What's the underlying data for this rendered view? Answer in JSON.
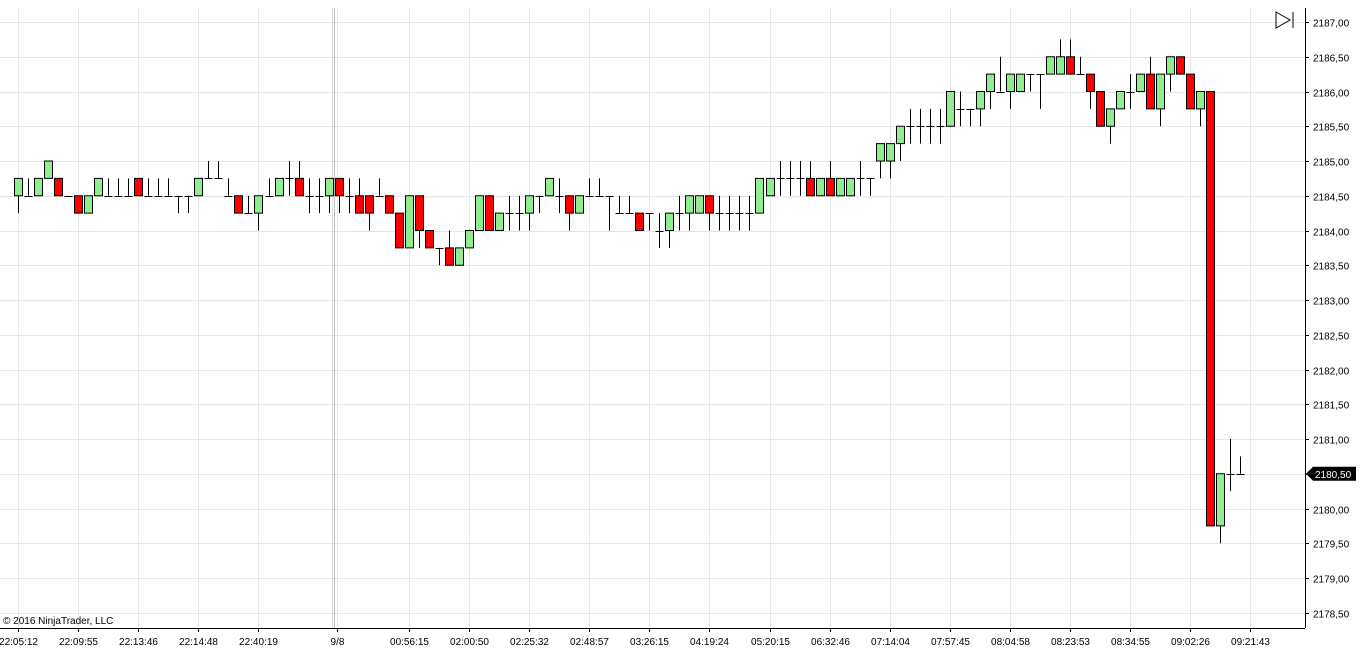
{
  "copyright": "© 2016 NinjaTrader, LLC",
  "last_price_label": "2180,50",
  "nav_button_icon": "skip-to-end-icon",
  "colors": {
    "up_candle": "#90ee90",
    "down_candle": "#ff0000",
    "wick": "#000000",
    "grid": "#e6e6e6",
    "price_marker_bg": "#000000",
    "price_marker_text": "#ffffff"
  },
  "chart_data": {
    "type": "candlestick",
    "grid": true,
    "ylim": [
      2178.25,
      2187.15
    ],
    "y_ticks": [
      "2187,00",
      "2186,50",
      "2186,00",
      "2185,50",
      "2185,00",
      "2184,50",
      "2184,00",
      "2183,50",
      "2183,00",
      "2182,50",
      "2182,00",
      "2181,50",
      "2181,00",
      "2180,50",
      "2180,00",
      "2179,50",
      "2179,00",
      "2178,50"
    ],
    "y_tick_values": [
      2187.0,
      2186.5,
      2186.0,
      2185.5,
      2185.0,
      2184.5,
      2184.0,
      2183.5,
      2183.0,
      2182.5,
      2182.0,
      2181.5,
      2181.0,
      2180.5,
      2180.0,
      2179.5,
      2179.0,
      2178.5
    ],
    "x_ticks": [
      {
        "label": "22:05:12",
        "bar": 0
      },
      {
        "label": "22:09:55",
        "bar": 6
      },
      {
        "label": "22:13:46",
        "bar": 12
      },
      {
        "label": "22:14:48",
        "bar": 18
      },
      {
        "label": "22:40:19",
        "bar": 24
      },
      {
        "label": "9/8",
        "bar": 31.8
      },
      {
        "label": "00:56:15",
        "bar": 39
      },
      {
        "label": "02:00:50",
        "bar": 45
      },
      {
        "label": "02:25:32",
        "bar": 51
      },
      {
        "label": "02:48:57",
        "bar": 57
      },
      {
        "label": "03:26:15",
        "bar": 63
      },
      {
        "label": "04:19:24",
        "bar": 69
      },
      {
        "label": "05:20:15",
        "bar": 75
      },
      {
        "label": "06:32:46",
        "bar": 81
      },
      {
        "label": "07:14:04",
        "bar": 87
      },
      {
        "label": "07:57:45",
        "bar": 93
      },
      {
        "label": "08:04:58",
        "bar": 99
      },
      {
        "label": "08:23:53",
        "bar": 105
      },
      {
        "label": "08:34:55",
        "bar": 111
      },
      {
        "label": "09:02:26",
        "bar": 117
      },
      {
        "label": "09:21:43",
        "bar": 123
      }
    ],
    "session_break_bar": 31,
    "candles": [
      {
        "o": 2184.5,
        "h": 2184.75,
        "l": 2184.25,
        "c": 2184.75
      },
      {
        "o": 2184.5,
        "h": 2184.75,
        "l": 2184.5,
        "c": 2184.5
      },
      {
        "o": 2184.5,
        "h": 2184.75,
        "l": 2184.5,
        "c": 2184.75
      },
      {
        "o": 2184.75,
        "h": 2185.0,
        "l": 2184.75,
        "c": 2185.0
      },
      {
        "o": 2184.75,
        "h": 2184.75,
        "l": 2184.5,
        "c": 2184.5
      },
      {
        "o": 2184.5,
        "h": 2184.5,
        "l": 2184.5,
        "c": 2184.5
      },
      {
        "o": 2184.5,
        "h": 2184.5,
        "l": 2184.25,
        "c": 2184.25
      },
      {
        "o": 2184.25,
        "h": 2184.5,
        "l": 2184.25,
        "c": 2184.5
      },
      {
        "o": 2184.5,
        "h": 2184.75,
        "l": 2184.5,
        "c": 2184.75
      },
      {
        "o": 2184.5,
        "h": 2184.75,
        "l": 2184.5,
        "c": 2184.5
      },
      {
        "o": 2184.5,
        "h": 2184.75,
        "l": 2184.5,
        "c": 2184.5
      },
      {
        "o": 2184.5,
        "h": 2184.75,
        "l": 2184.5,
        "c": 2184.5
      },
      {
        "o": 2184.75,
        "h": 2184.75,
        "l": 2184.5,
        "c": 2184.5
      },
      {
        "o": 2184.5,
        "h": 2184.75,
        "l": 2184.5,
        "c": 2184.5
      },
      {
        "o": 2184.5,
        "h": 2184.75,
        "l": 2184.5,
        "c": 2184.5
      },
      {
        "o": 2184.5,
        "h": 2184.75,
        "l": 2184.5,
        "c": 2184.5
      },
      {
        "o": 2184.5,
        "h": 2184.5,
        "l": 2184.25,
        "c": 2184.5
      },
      {
        "o": 2184.5,
        "h": 2184.5,
        "l": 2184.25,
        "c": 2184.5
      },
      {
        "o": 2184.5,
        "h": 2184.75,
        "l": 2184.5,
        "c": 2184.75
      },
      {
        "o": 2184.75,
        "h": 2185.0,
        "l": 2184.75,
        "c": 2184.75
      },
      {
        "o": 2184.75,
        "h": 2185.0,
        "l": 2184.75,
        "c": 2184.75
      },
      {
        "o": 2184.5,
        "h": 2184.75,
        "l": 2184.5,
        "c": 2184.5
      },
      {
        "o": 2184.5,
        "h": 2184.5,
        "l": 2184.25,
        "c": 2184.25
      },
      {
        "o": 2184.25,
        "h": 2184.5,
        "l": 2184.25,
        "c": 2184.25
      },
      {
        "o": 2184.25,
        "h": 2184.5,
        "l": 2184.0,
        "c": 2184.5
      },
      {
        "o": 2184.5,
        "h": 2184.75,
        "l": 2184.5,
        "c": 2184.5
      },
      {
        "o": 2184.5,
        "h": 2184.75,
        "l": 2184.5,
        "c": 2184.75
      },
      {
        "o": 2184.75,
        "h": 2185.0,
        "l": 2184.5,
        "c": 2184.75
      },
      {
        "o": 2184.75,
        "h": 2185.0,
        "l": 2184.5,
        "c": 2184.5
      },
      {
        "o": 2184.5,
        "h": 2184.75,
        "l": 2184.25,
        "c": 2184.5
      },
      {
        "o": 2184.5,
        "h": 2184.75,
        "l": 2184.25,
        "c": 2184.5
      },
      {
        "o": 2184.5,
        "h": 2184.75,
        "l": 2184.25,
        "c": 2184.75
      },
      {
        "o": 2184.75,
        "h": 2184.75,
        "l": 2184.25,
        "c": 2184.5
      },
      {
        "o": 2184.5,
        "h": 2184.75,
        "l": 2184.25,
        "c": 2184.5
      },
      {
        "o": 2184.5,
        "h": 2184.75,
        "l": 2184.25,
        "c": 2184.25
      },
      {
        "o": 2184.5,
        "h": 2184.5,
        "l": 2184.0,
        "c": 2184.25
      },
      {
        "o": 2184.5,
        "h": 2184.75,
        "l": 2184.5,
        "c": 2184.5
      },
      {
        "o": 2184.5,
        "h": 2184.5,
        "l": 2184.25,
        "c": 2184.25
      },
      {
        "o": 2184.25,
        "h": 2184.25,
        "l": 2183.75,
        "c": 2183.75
      },
      {
        "o": 2183.75,
        "h": 2184.5,
        "l": 2183.75,
        "c": 2184.5
      },
      {
        "o": 2184.5,
        "h": 2184.5,
        "l": 2183.75,
        "c": 2184.0
      },
      {
        "o": 2184.0,
        "h": 2184.0,
        "l": 2183.75,
        "c": 2183.75
      },
      {
        "o": 2183.75,
        "h": 2183.75,
        "l": 2183.5,
        "c": 2183.75
      },
      {
        "o": 2183.75,
        "h": 2184.0,
        "l": 2183.5,
        "c": 2183.5
      },
      {
        "o": 2183.5,
        "h": 2183.75,
        "l": 2183.5,
        "c": 2183.75
      },
      {
        "o": 2183.75,
        "h": 2184.0,
        "l": 2183.75,
        "c": 2184.0
      },
      {
        "o": 2184.0,
        "h": 2184.5,
        "l": 2184.0,
        "c": 2184.5
      },
      {
        "o": 2184.5,
        "h": 2184.5,
        "l": 2184.0,
        "c": 2184.0
      },
      {
        "o": 2184.0,
        "h": 2184.25,
        "l": 2184.0,
        "c": 2184.25
      },
      {
        "o": 2184.25,
        "h": 2184.5,
        "l": 2184.0,
        "c": 2184.25
      },
      {
        "o": 2184.25,
        "h": 2184.5,
        "l": 2184.0,
        "c": 2184.25
      },
      {
        "o": 2184.25,
        "h": 2184.5,
        "l": 2184.0,
        "c": 2184.5
      },
      {
        "o": 2184.5,
        "h": 2184.5,
        "l": 2184.25,
        "c": 2184.5
      },
      {
        "o": 2184.5,
        "h": 2184.75,
        "l": 2184.5,
        "c": 2184.75
      },
      {
        "o": 2184.5,
        "h": 2184.75,
        "l": 2184.25,
        "c": 2184.5
      },
      {
        "o": 2184.5,
        "h": 2184.5,
        "l": 2184.0,
        "c": 2184.25
      },
      {
        "o": 2184.25,
        "h": 2184.5,
        "l": 2184.25,
        "c": 2184.5
      },
      {
        "o": 2184.5,
        "h": 2184.75,
        "l": 2184.5,
        "c": 2184.5
      },
      {
        "o": 2184.5,
        "h": 2184.75,
        "l": 2184.5,
        "c": 2184.5
      },
      {
        "o": 2184.5,
        "h": 2184.5,
        "l": 2184.0,
        "c": 2184.5
      },
      {
        "o": 2184.25,
        "h": 2184.5,
        "l": 2184.25,
        "c": 2184.25
      },
      {
        "o": 2184.25,
        "h": 2184.5,
        "l": 2184.25,
        "c": 2184.25
      },
      {
        "o": 2184.25,
        "h": 2184.25,
        "l": 2184.0,
        "c": 2184.0
      },
      {
        "o": 2184.25,
        "h": 2184.25,
        "l": 2184.0,
        "c": 2184.25
      },
      {
        "o": 2184.0,
        "h": 2184.25,
        "l": 2183.75,
        "c": 2184.0
      },
      {
        "o": 2184.0,
        "h": 2184.25,
        "l": 2183.75,
        "c": 2184.25
      },
      {
        "o": 2184.25,
        "h": 2184.5,
        "l": 2184.0,
        "c": 2184.25
      },
      {
        "o": 2184.25,
        "h": 2184.5,
        "l": 2184.0,
        "c": 2184.5
      },
      {
        "o": 2184.25,
        "h": 2184.5,
        "l": 2184.25,
        "c": 2184.5
      },
      {
        "o": 2184.5,
        "h": 2184.5,
        "l": 2184.0,
        "c": 2184.25
      },
      {
        "o": 2184.25,
        "h": 2184.5,
        "l": 2184.0,
        "c": 2184.25
      },
      {
        "o": 2184.25,
        "h": 2184.5,
        "l": 2184.0,
        "c": 2184.25
      },
      {
        "o": 2184.25,
        "h": 2184.5,
        "l": 2184.0,
        "c": 2184.25
      },
      {
        "o": 2184.25,
        "h": 2184.5,
        "l": 2184.0,
        "c": 2184.25
      },
      {
        "o": 2184.25,
        "h": 2184.75,
        "l": 2184.25,
        "c": 2184.75
      },
      {
        "o": 2184.5,
        "h": 2184.75,
        "l": 2184.5,
        "c": 2184.75
      },
      {
        "o": 2184.75,
        "h": 2185.0,
        "l": 2184.5,
        "c": 2184.75
      },
      {
        "o": 2184.75,
        "h": 2185.0,
        "l": 2184.5,
        "c": 2184.75
      },
      {
        "o": 2184.75,
        "h": 2185.0,
        "l": 2184.5,
        "c": 2184.75
      },
      {
        "o": 2184.75,
        "h": 2185.0,
        "l": 2184.5,
        "c": 2184.5
      },
      {
        "o": 2184.5,
        "h": 2184.75,
        "l": 2184.5,
        "c": 2184.75
      },
      {
        "o": 2184.75,
        "h": 2185.0,
        "l": 2184.5,
        "c": 2184.5
      },
      {
        "o": 2184.5,
        "h": 2184.75,
        "l": 2184.5,
        "c": 2184.75
      },
      {
        "o": 2184.5,
        "h": 2184.75,
        "l": 2184.5,
        "c": 2184.75
      },
      {
        "o": 2184.75,
        "h": 2185.0,
        "l": 2184.5,
        "c": 2184.75
      },
      {
        "o": 2184.75,
        "h": 2184.75,
        "l": 2184.5,
        "c": 2184.75
      },
      {
        "o": 2185.0,
        "h": 2185.25,
        "l": 2184.75,
        "c": 2185.25
      },
      {
        "o": 2185.0,
        "h": 2185.25,
        "l": 2184.75,
        "c": 2185.25
      },
      {
        "o": 2185.25,
        "h": 2185.5,
        "l": 2185.0,
        "c": 2185.5
      },
      {
        "o": 2185.5,
        "h": 2185.75,
        "l": 2185.25,
        "c": 2185.5
      },
      {
        "o": 2185.5,
        "h": 2185.75,
        "l": 2185.25,
        "c": 2185.5
      },
      {
        "o": 2185.5,
        "h": 2185.75,
        "l": 2185.25,
        "c": 2185.5
      },
      {
        "o": 2185.5,
        "h": 2185.75,
        "l": 2185.25,
        "c": 2185.5
      },
      {
        "o": 2185.5,
        "h": 2186.0,
        "l": 2185.5,
        "c": 2186.0
      },
      {
        "o": 2185.75,
        "h": 2186.0,
        "l": 2185.5,
        "c": 2185.75
      },
      {
        "o": 2185.75,
        "h": 2185.75,
        "l": 2185.5,
        "c": 2185.75
      },
      {
        "o": 2185.75,
        "h": 2186.0,
        "l": 2185.5,
        "c": 2186.0
      },
      {
        "o": 2186.0,
        "h": 2186.25,
        "l": 2185.75,
        "c": 2186.25
      },
      {
        "o": 2186.0,
        "h": 2186.5,
        "l": 2186.0,
        "c": 2186.0
      },
      {
        "o": 2186.0,
        "h": 2186.25,
        "l": 2185.75,
        "c": 2186.25
      },
      {
        "o": 2186.0,
        "h": 2186.25,
        "l": 2186.0,
        "c": 2186.25
      },
      {
        "o": 2186.25,
        "h": 2186.25,
        "l": 2186.0,
        "c": 2186.25
      },
      {
        "o": 2186.25,
        "h": 2186.25,
        "l": 2185.75,
        "c": 2186.25
      },
      {
        "o": 2186.25,
        "h": 2186.5,
        "l": 2186.25,
        "c": 2186.5
      },
      {
        "o": 2186.25,
        "h": 2186.75,
        "l": 2186.25,
        "c": 2186.5
      },
      {
        "o": 2186.5,
        "h": 2186.75,
        "l": 2186.25,
        "c": 2186.25
      },
      {
        "o": 2186.25,
        "h": 2186.5,
        "l": 2186.25,
        "c": 2186.25
      },
      {
        "o": 2186.25,
        "h": 2186.25,
        "l": 2185.75,
        "c": 2186.0
      },
      {
        "o": 2186.0,
        "h": 2186.0,
        "l": 2185.5,
        "c": 2185.5
      },
      {
        "o": 2185.5,
        "h": 2185.75,
        "l": 2185.25,
        "c": 2185.75
      },
      {
        "o": 2185.75,
        "h": 2186.0,
        "l": 2185.75,
        "c": 2186.0
      },
      {
        "o": 2186.0,
        "h": 2186.25,
        "l": 2185.75,
        "c": 2186.0
      },
      {
        "o": 2186.0,
        "h": 2186.25,
        "l": 2186.0,
        "c": 2186.25
      },
      {
        "o": 2186.25,
        "h": 2186.5,
        "l": 2185.75,
        "c": 2185.75
      },
      {
        "o": 2185.75,
        "h": 2186.25,
        "l": 2185.5,
        "c": 2186.25
      },
      {
        "o": 2186.25,
        "h": 2186.5,
        "l": 2186.0,
        "c": 2186.5
      },
      {
        "o": 2186.5,
        "h": 2186.5,
        "l": 2186.25,
        "c": 2186.25
      },
      {
        "o": 2186.25,
        "h": 2186.25,
        "l": 2185.75,
        "c": 2185.75
      },
      {
        "o": 2185.75,
        "h": 2186.0,
        "l": 2185.5,
        "c": 2186.0
      },
      {
        "o": 2186.0,
        "h": 2186.0,
        "l": 2179.75,
        "c": 2179.75
      },
      {
        "o": 2179.75,
        "h": 2180.5,
        "l": 2179.5,
        "c": 2180.5
      },
      {
        "o": 2180.5,
        "h": 2181.0,
        "l": 2180.25,
        "c": 2180.5
      },
      {
        "o": 2180.5,
        "h": 2180.75,
        "l": 2180.5,
        "c": 2180.5
      }
    ]
  }
}
